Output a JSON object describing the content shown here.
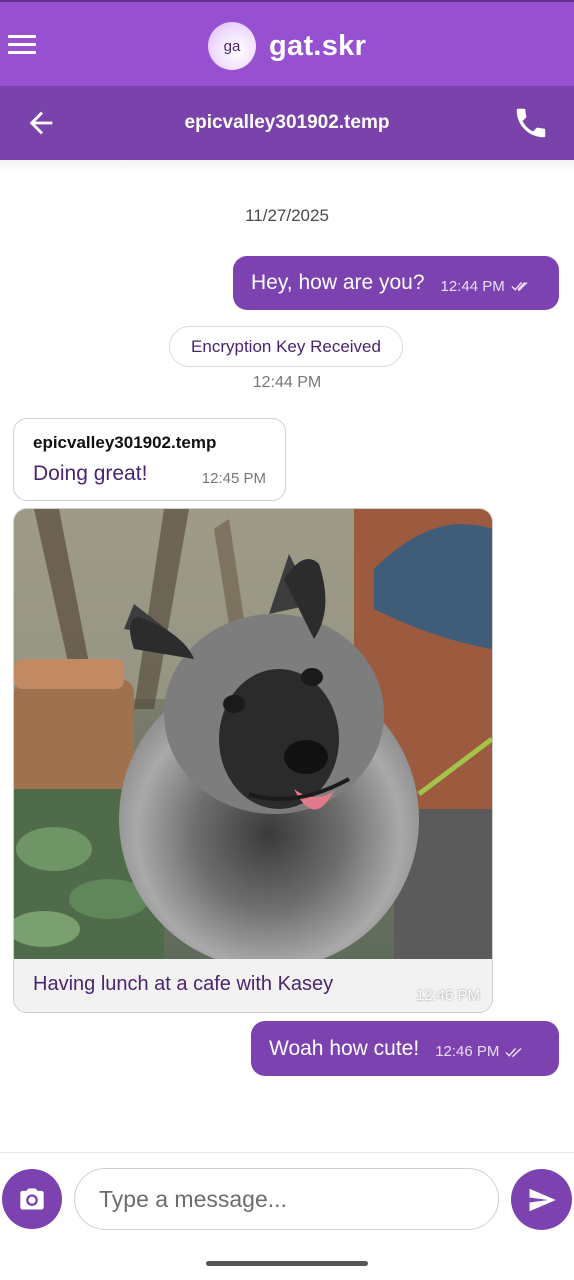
{
  "app": {
    "avatar_initials": "ga",
    "name": "gat.skr"
  },
  "conversation": {
    "title": "epicvalley301902.temp"
  },
  "messages": {
    "date": "11/27/2025",
    "m1": {
      "text": "Hey, how are you?",
      "time": "12:44 PM"
    },
    "system": {
      "text": "Encryption Key Received",
      "time": "12:44 PM"
    },
    "m2": {
      "sender": "epicvalley301902.temp",
      "text": "Doing great!",
      "time": "12:45 PM"
    },
    "m3": {
      "caption": "Having lunch at a cafe with Kasey",
      "time": "12:46 PM"
    },
    "m4": {
      "text": "Woah how cute!",
      "time": "12:46 PM"
    }
  },
  "composer": {
    "placeholder": "Type a message..."
  },
  "colors": {
    "appbar": "#9750cf",
    "subbar": "#7a43ac",
    "outgoing_bubble": "#7c43b0",
    "incoming_text": "#4a2470"
  },
  "icons": [
    "menu-icon",
    "back-arrow-icon",
    "phone-icon",
    "double-check-icon",
    "camera-icon",
    "send-icon"
  ]
}
